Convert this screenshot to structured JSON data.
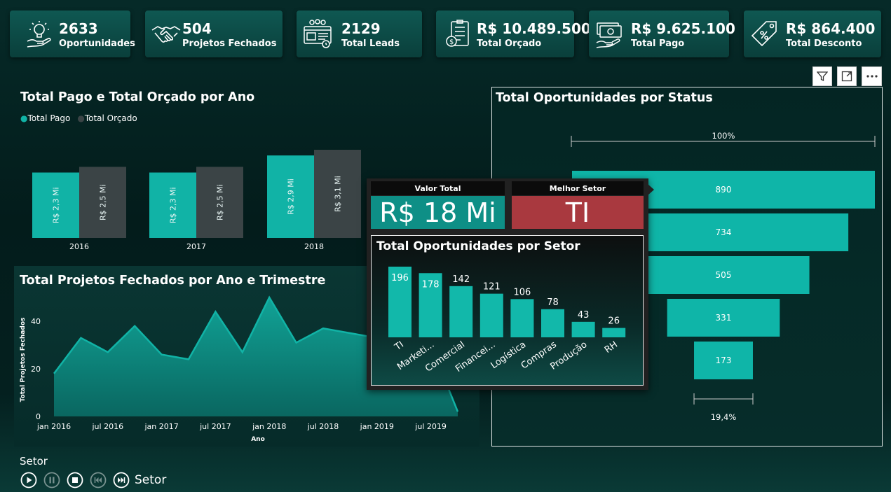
{
  "kpis": [
    {
      "value": "2633",
      "label": "Oportunidades",
      "icon": "lightbulb-hand-icon"
    },
    {
      "value": "504",
      "label": "Projetos Fechados",
      "icon": "handshake-icon"
    },
    {
      "value": "2129",
      "label": "Total Leads",
      "icon": "leads-screen-icon"
    },
    {
      "value": "R$ 10.489.500",
      "label": "Total Orçado",
      "icon": "budget-document-icon"
    },
    {
      "value": "R$ 9.625.100",
      "label": "Total Pago",
      "icon": "money-hand-icon"
    },
    {
      "value": "R$ 864.400",
      "label": "Total Desconto",
      "icon": "discount-tag-icon"
    }
  ],
  "bar_chart": {
    "title": "Total Pago e Total Orçado por Ano",
    "legend": [
      "Total Pago",
      "Total Orçado"
    ],
    "colors": {
      "pago": "#11b3a6",
      "orcado": "#3b4446"
    },
    "years": [
      "2016",
      "2017",
      "2018"
    ],
    "pago_labels": [
      "R$ 2,3 Mi",
      "R$ 2,3 Mi",
      "R$ 2,9 Mi"
    ],
    "orcado_labels": [
      "R$ 2,5 Mi",
      "R$ 2,5 Mi",
      "R$ 3,1 Mi"
    ]
  },
  "area_chart": {
    "title": "Total Projetos Fechados por Ano e Trimestre",
    "ylabel": "Total Projetos Fechados",
    "xlabel": "Ano",
    "y_ticks": [
      "40",
      "20",
      "0"
    ],
    "x_ticks": [
      "jan 2016",
      "jul 2016",
      "jan 2017",
      "jul 2017",
      "jan 2018",
      "jul 2018",
      "jan 2019",
      "jul 2019"
    ],
    "color": "#11b3a6"
  },
  "funnel": {
    "title": "Total Oportunidades por Status",
    "top_pct": "100%",
    "bottom_pct": "19,4%",
    "values": [
      "890",
      "734",
      "505",
      "331",
      "173"
    ],
    "color": "#0fb5a8"
  },
  "tooltip": {
    "valor_total_header": "Valor Total",
    "valor_total": "R$ 18 Mi",
    "melhor_setor_header": "Melhor Setor",
    "melhor_setor": "TI",
    "setor_title": "Total Oportunidades por Setor",
    "colors": {
      "valor": "#0e8f86",
      "setor": "#a9393f"
    }
  },
  "toolbar": {
    "filter_icon": "filter-icon",
    "focus_icon": "focus-mode-icon",
    "more_icon": "more-options-icon"
  },
  "play_axis": {
    "title": "Setor",
    "current": "Setor"
  },
  "chart_data": [
    {
      "type": "bar",
      "title": "Total Pago e Total Orçado por Ano",
      "categories": [
        "2016",
        "2017",
        "2018"
      ],
      "series": [
        {
          "name": "Total Pago",
          "values": [
            2.3,
            2.3,
            2.9
          ]
        },
        {
          "name": "Total Orçado",
          "values": [
            2.5,
            2.5,
            3.1
          ]
        }
      ],
      "legend": "top-left"
    },
    {
      "type": "area",
      "title": "Total Projetos Fechados por Ano e Trimestre",
      "xlabel": "Ano",
      "ylabel": "Total Projetos Fechados",
      "x": [
        "2016-01",
        "2016-04",
        "2016-07",
        "2016-10",
        "2017-01",
        "2017-04",
        "2017-07",
        "2017-10",
        "2018-01",
        "2018-04",
        "2018-07",
        "2018-10",
        "2019-01",
        "2019-04",
        "2019-07",
        "2019-10"
      ],
      "y": [
        18,
        33,
        27,
        38,
        26,
        24,
        44,
        27,
        50,
        31,
        37,
        35,
        33,
        32,
        30,
        2
      ],
      "ylim": [
        0,
        50
      ]
    },
    {
      "type": "funnel",
      "title": "Total Oportunidades por Status",
      "values": [
        890,
        734,
        505,
        331,
        173
      ]
    },
    {
      "type": "bar",
      "title": "Total Oportunidades por Setor",
      "categories": [
        "TI",
        "Marketi...",
        "Comercial",
        "Financei...",
        "Logística",
        "Compras",
        "Produção",
        "RH"
      ],
      "values": [
        196,
        178,
        142,
        121,
        106,
        78,
        43,
        26
      ]
    }
  ]
}
